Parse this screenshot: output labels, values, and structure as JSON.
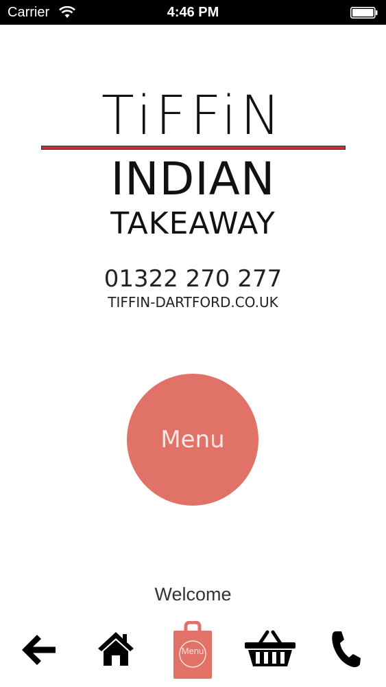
{
  "status_bar": {
    "carrier": "Carrier",
    "time": "4:46 PM"
  },
  "logo": {
    "line1": "TiFFiN",
    "line2": "INDIAN",
    "line3": "TAKEAWAY",
    "rule_color": "#c1333b"
  },
  "contact": {
    "phone": "01322 270 277",
    "website": "TIFFIN-DARTFORD.CO.UK"
  },
  "menu_button": {
    "label": "Menu",
    "color": "#e07268"
  },
  "welcome_text": "Welcome",
  "toolbar": {
    "items": [
      {
        "icon": "back-arrow-icon"
      },
      {
        "icon": "home-icon"
      },
      {
        "icon": "menu-bag-icon",
        "label": "Menu"
      },
      {
        "icon": "basket-icon"
      },
      {
        "icon": "phone-icon"
      }
    ]
  }
}
